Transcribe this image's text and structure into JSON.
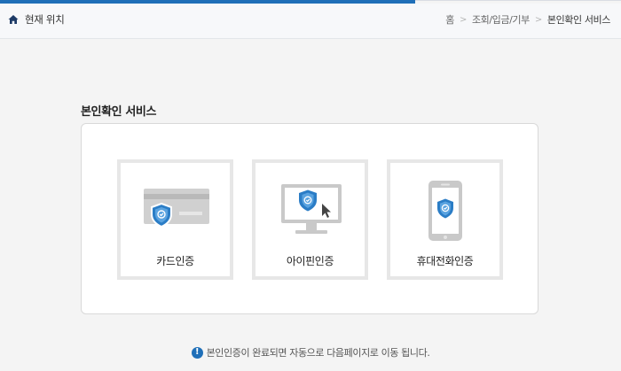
{
  "location_bar": {
    "label": "현재 위치",
    "breadcrumbs": [
      "홈",
      "조회/입금/기부",
      "본인확인 서비스"
    ]
  },
  "section": {
    "title": "본인확인 서비스"
  },
  "methods": [
    {
      "label": "카드인증",
      "icon": "credit-card-shield-icon"
    },
    {
      "label": "아이핀인증",
      "icon": "monitor-shield-icon"
    },
    {
      "label": "휴대전화인증",
      "icon": "mobile-phone-shield-icon"
    }
  ],
  "notice": {
    "icon": "exclamation-icon",
    "text": "본인인증이 완료되면 자동으로 다음페이지로 이동 됩니다."
  },
  "colors": {
    "accent": "#1f6fb8",
    "shield": "#2b7dc6",
    "illustration_gray": "#c9c9c9"
  }
}
